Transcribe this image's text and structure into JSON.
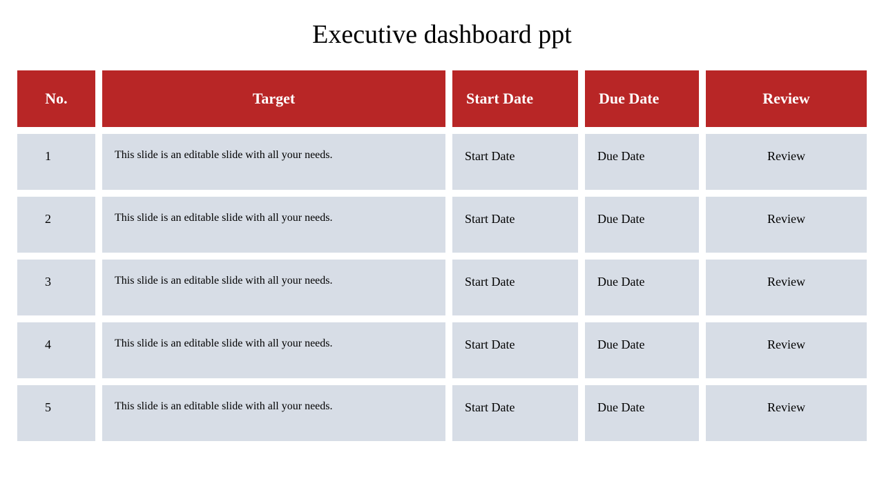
{
  "title": "Executive dashboard ppt",
  "headers": {
    "no": "No.",
    "target": "Target",
    "start": "Start  Date",
    "due": "Due Date",
    "review": "Review"
  },
  "rows": [
    {
      "no": "1",
      "target": "This slide is an editable slide with all your needs.",
      "start": "Start  Date",
      "due": "Due Date",
      "review": "Review"
    },
    {
      "no": "2",
      "target": "This slide is an editable slide with all your needs.",
      "start": "Start  Date",
      "due": "Due Date",
      "review": "Review"
    },
    {
      "no": "3",
      "target": "This slide is an editable slide with all your needs.",
      "start": "Start  Date",
      "due": "Due Date",
      "review": "Review"
    },
    {
      "no": "4",
      "target": "This slide is an editable slide with all your needs.",
      "start": "Start  Date",
      "due": "Due Date",
      "review": "Review"
    },
    {
      "no": "5",
      "target": "This slide is an editable slide with all your needs.",
      "start": "Start  Date",
      "due": "Due Date",
      "review": "Review"
    }
  ]
}
